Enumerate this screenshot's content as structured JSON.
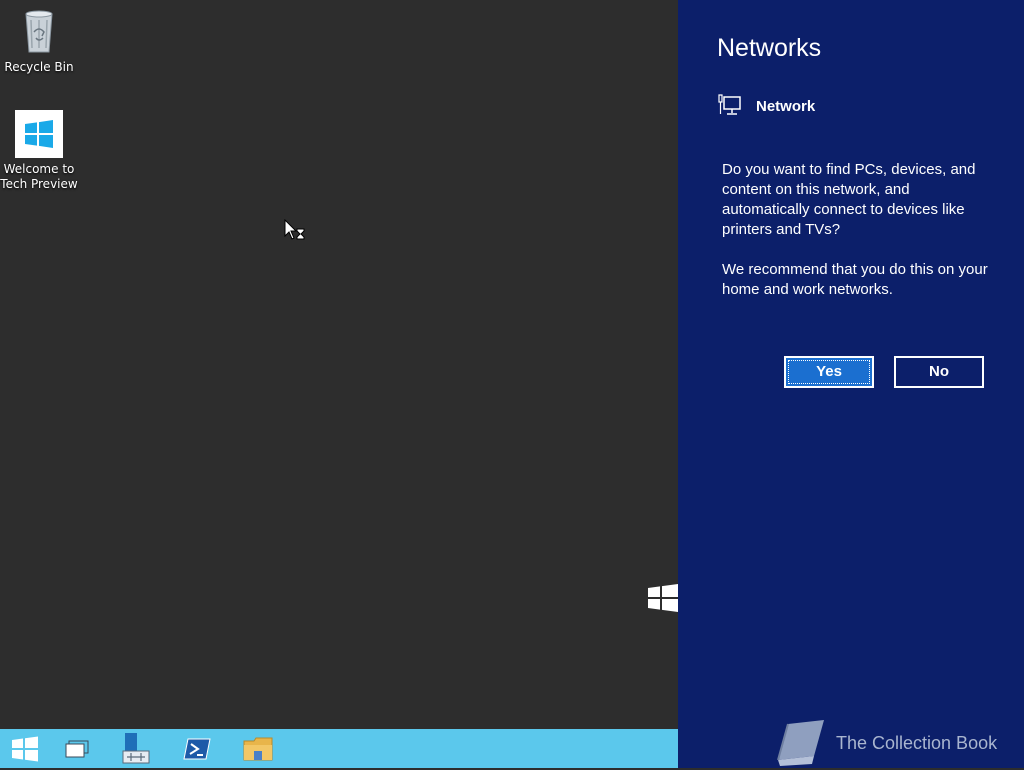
{
  "desktop": {
    "icons": [
      {
        "label": "Recycle Bin",
        "icon": "recycle-bin-icon"
      },
      {
        "label": "Welcome to Tech Preview",
        "icon": "windows-logo-icon"
      }
    ]
  },
  "taskbar": {
    "items": [
      {
        "name": "start",
        "icon": "windows-logo-icon"
      },
      {
        "name": "task-view",
        "icon": "task-view-icon"
      },
      {
        "name": "server-manager",
        "icon": "server-manager-icon"
      },
      {
        "name": "powershell",
        "icon": "powershell-icon"
      },
      {
        "name": "file-explorer",
        "icon": "folder-icon"
      }
    ],
    "color": "#5bc8ec"
  },
  "panel": {
    "title": "Networks",
    "network_name": "Network",
    "prompt_line1": "Do you want to find PCs, devices, and content on this network, and automatically connect to devices like printers and TVs?",
    "prompt_line2": "We recommend that you do this on your home and work networks.",
    "yes_label": "Yes",
    "no_label": "No",
    "background": "#0c1f6a",
    "accent": "#1b6fd0"
  },
  "watermark": {
    "text": "The Collection Book",
    "icon": "book-icon"
  }
}
